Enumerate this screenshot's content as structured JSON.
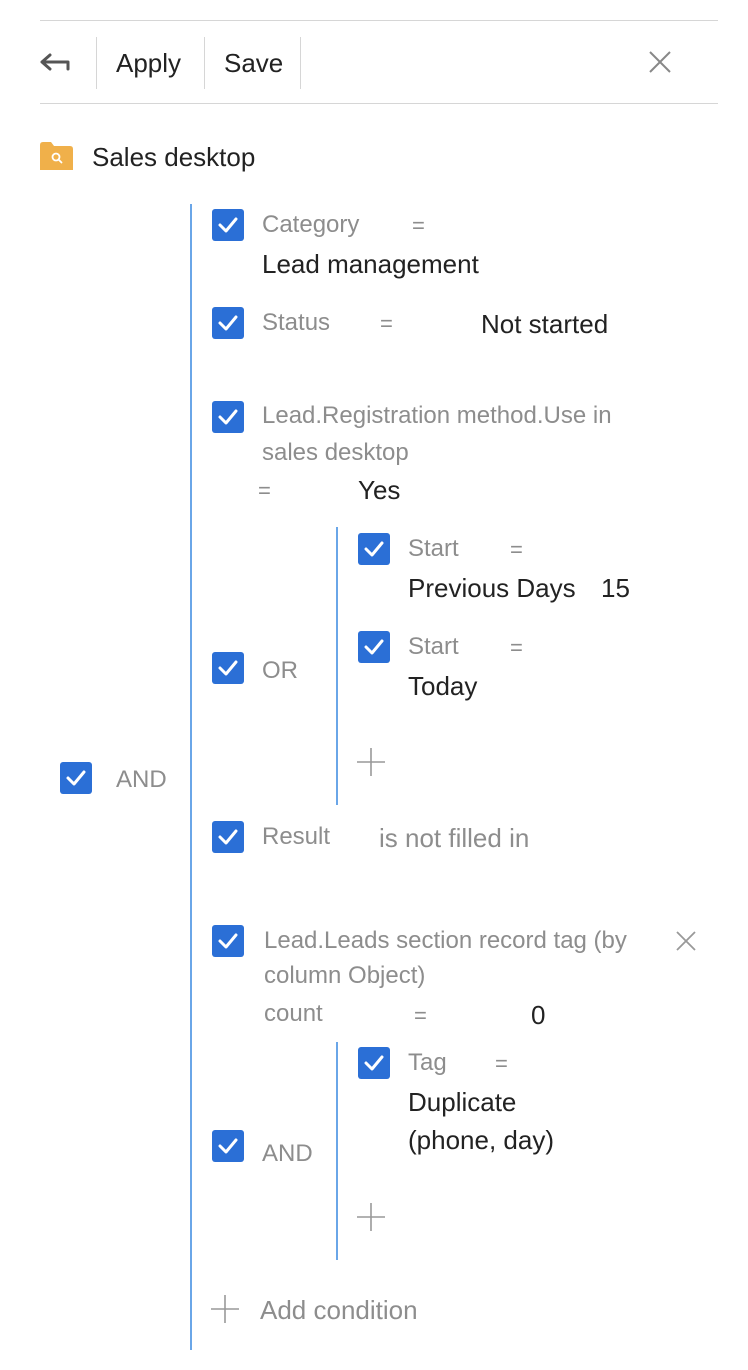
{
  "toolbar": {
    "back_icon": "back-arrow-icon",
    "apply_label": "Apply",
    "save_label": "Save",
    "close_icon": "close-icon"
  },
  "folder": {
    "icon": "folder-search-icon",
    "name": "Sales desktop",
    "icon_color": "#f0b04a"
  },
  "accent_colors": {
    "checkbox": "#2b6fd6",
    "group_line": "#6aa6e8"
  },
  "root_group": {
    "operator": "AND",
    "checked": true
  },
  "conditions": {
    "category": {
      "column": "Category",
      "op": "=",
      "value": "Lead management",
      "checked": true
    },
    "status": {
      "column": "Status",
      "op": "=",
      "value": "Not started",
      "checked": true
    },
    "registration": {
      "column_line1": "Lead.Registration method.Use in",
      "column_line2": "sales desktop",
      "op": "=",
      "value": "Yes",
      "checked": true
    },
    "or_group": {
      "operator": "OR",
      "checked": true,
      "start1": {
        "column": "Start",
        "op": "=",
        "value": "Previous Days",
        "value2": "15",
        "checked": true
      },
      "start2": {
        "column": "Start",
        "op": "=",
        "value": "Today",
        "checked": true
      }
    },
    "result": {
      "column": "Result",
      "op": "is not filled in",
      "checked": true
    },
    "tag_aggregate": {
      "column_line1": "Lead.Leads section record tag (by",
      "column_line2": "column Object)",
      "func": "count",
      "op": "=",
      "value": "0",
      "checked": true,
      "and_group": {
        "operator": "AND",
        "checked": true,
        "tag": {
          "column": "Tag",
          "op": "=",
          "value_line1": "Duplicate",
          "value_line2": "(phone, day)",
          "checked": true
        }
      }
    }
  },
  "add_condition_label": "Add condition"
}
